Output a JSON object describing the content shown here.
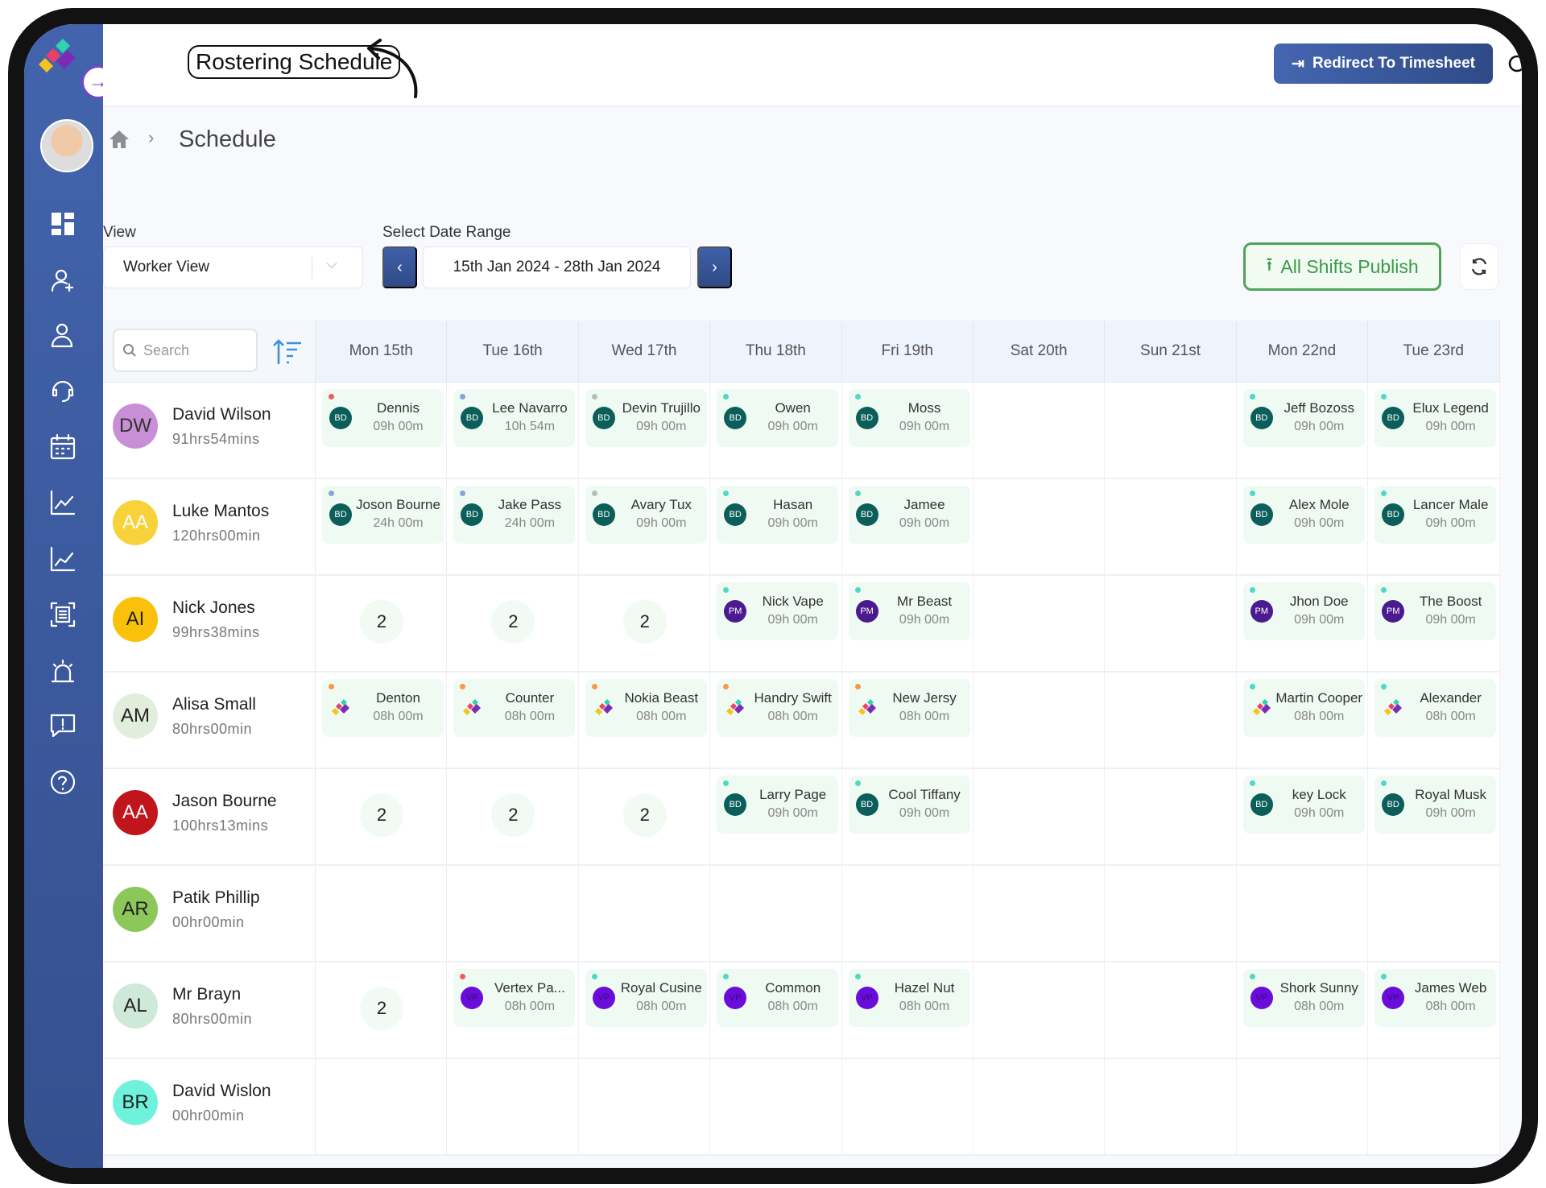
{
  "header": {
    "title": "Rostering Schedule",
    "redirect_label": "Redirect To Timesheet",
    "icons": [
      "search-icon",
      "bell-icon"
    ]
  },
  "breadcrumb": {
    "current": "Schedule"
  },
  "controls": {
    "view_label": "View",
    "view_value": "Worker View",
    "date_label": "Select Date Range",
    "date_value": "15th Jan 2024 - 28th Jan 2024",
    "publish_label": "All Shifts Publish",
    "prev": "‹",
    "next": "›"
  },
  "search": {
    "placeholder": "Search"
  },
  "sidebar": {
    "icons": [
      "dashboard-icon",
      "add-user-icon",
      "users-icon",
      "support-icon",
      "calendar-icon",
      "chart-icon",
      "analytics-icon",
      "report-icon",
      "alarm-icon",
      "feedback-icon",
      "help-icon"
    ]
  },
  "colors": {
    "accent": "#3f5fa8",
    "publish": "#3a9a48",
    "bd": "#0b5e5a",
    "pm": "#4b1a8f",
    "vp": "#6a0ddb",
    "red": "#ef5b5b",
    "blue": "#7fa8d6",
    "grey": "#bbbbbb",
    "teal": "#4fd8c4",
    "orange": "#f59a4a"
  },
  "days": [
    "Mon 15th",
    "Tue 16th",
    "Wed 17th",
    "Thu 18th",
    "Fri 19th",
    "Sat 20th",
    "Sun 21st",
    "Mon 22nd",
    "Tue 23rd"
  ],
  "workers": [
    {
      "name": "David Wilson",
      "initials": "DW",
      "bg": "#c98fd6",
      "fg": "#333",
      "hours": "91hrs54mins",
      "cells": [
        {
          "n": "Dennis",
          "d": "09h 00m",
          "b": "BD",
          "dot": "red"
        },
        {
          "n": "Lee Navarro",
          "d": "10h 54m",
          "b": "BD",
          "dot": "blue"
        },
        {
          "n": "Devin Trujillo",
          "d": "09h 00m",
          "b": "BD",
          "dot": "grey"
        },
        {
          "n": "Owen",
          "d": "09h 00m",
          "b": "BD",
          "dot": "teal"
        },
        {
          "n": "Moss",
          "d": "09h 00m",
          "b": "BD",
          "dot": "teal"
        },
        null,
        null,
        {
          "n": "Jeff Bozoss",
          "d": "09h 00m",
          "b": "BD",
          "dot": "teal"
        },
        {
          "n": "Elux Legend",
          "d": "09h 00m",
          "b": "BD",
          "dot": "teal"
        }
      ]
    },
    {
      "name": "Luke Mantos",
      "initials": "AA",
      "bg": "#f8d23a",
      "fg": "#fff",
      "hours": "120hrs00min",
      "cells": [
        {
          "n": "Joson Bourne",
          "d": "24h 00m",
          "b": "BD",
          "dot": "blue"
        },
        {
          "n": "Jake Pass",
          "d": "24h 00m",
          "b": "BD",
          "dot": "blue"
        },
        {
          "n": "Avary Tux",
          "d": "09h 00m",
          "b": "BD",
          "dot": "grey"
        },
        {
          "n": "Hasan",
          "d": "09h 00m",
          "b": "BD",
          "dot": "teal"
        },
        {
          "n": "Jamee",
          "d": "09h 00m",
          "b": "BD",
          "dot": "teal"
        },
        null,
        null,
        {
          "n": "Alex Mole",
          "d": "09h 00m",
          "b": "BD",
          "dot": "teal"
        },
        {
          "n": "Lancer Male",
          "d": "09h 00m",
          "b": "BD",
          "dot": "teal"
        }
      ]
    },
    {
      "name": "Nick Jones",
      "initials": "AI",
      "bg": "#f9c10c",
      "fg": "#222",
      "hours": "99hrs38mins",
      "cells": [
        {
          "count": "2"
        },
        {
          "count": "2"
        },
        {
          "count": "2"
        },
        {
          "n": "Nick Vape",
          "d": "09h 00m",
          "b": "PM",
          "dot": "teal"
        },
        {
          "n": "Mr Beast",
          "d": "09h 00m",
          "b": "PM",
          "dot": "teal"
        },
        null,
        null,
        {
          "n": "Jhon Doe",
          "d": "09h 00m",
          "b": "PM",
          "dot": "teal"
        },
        {
          "n": "The Boost",
          "d": "09h 00m",
          "b": "PM",
          "dot": "teal"
        }
      ]
    },
    {
      "name": "Alisa Small",
      "initials": "AM",
      "bg": "#e0eedb",
      "fg": "#222",
      "hours": "80hrs00min",
      "cells": [
        {
          "n": "Denton",
          "d": "08h 00m",
          "b": "LOGO",
          "dot": "orange"
        },
        {
          "n": "Counter",
          "d": "08h 00m",
          "b": "LOGO",
          "dot": "orange"
        },
        {
          "n": "Nokia Beast",
          "d": "08h 00m",
          "b": "LOGO",
          "dot": "orange"
        },
        {
          "n": "Handry Swift",
          "d": "08h 00m",
          "b": "LOGO",
          "dot": "orange"
        },
        {
          "n": "New Jersy",
          "d": "08h 00m",
          "b": "LOGO",
          "dot": "orange"
        },
        null,
        null,
        {
          "n": "Martin Cooper",
          "d": "08h 00m",
          "b": "LOGO",
          "dot": "teal"
        },
        {
          "n": "Alexander",
          "d": "08h 00m",
          "b": "LOGO",
          "dot": "teal"
        }
      ]
    },
    {
      "name": "Jason Bourne",
      "initials": "AA",
      "bg": "#c0161b",
      "fg": "#fff",
      "hours": "100hrs13mins",
      "cells": [
        {
          "count": "2"
        },
        {
          "count": "2"
        },
        {
          "count": "2"
        },
        {
          "n": "Larry Page",
          "d": "09h 00m",
          "b": "BD",
          "dot": "teal"
        },
        {
          "n": "Cool Tiffany",
          "d": "09h 00m",
          "b": "BD",
          "dot": "teal"
        },
        null,
        null,
        {
          "n": "key Lock",
          "d": "09h 00m",
          "b": "BD",
          "dot": "teal"
        },
        {
          "n": "Royal Musk",
          "d": "09h 00m",
          "b": "BD",
          "dot": "teal"
        }
      ]
    },
    {
      "name": "Patik Phillip",
      "initials": "AR",
      "bg": "#8cc75a",
      "fg": "#222",
      "hours": "00hr00min",
      "cells": [
        null,
        null,
        null,
        null,
        null,
        null,
        null,
        null,
        null
      ]
    },
    {
      "name": "Mr Brayn",
      "initials": "AL",
      "bg": "#cfe9d8",
      "fg": "#222",
      "hours": "80hrs00min",
      "cells": [
        {
          "count": "2"
        },
        {
          "n": "Vertex Pa...",
          "d": "08h 00m",
          "b": "VP",
          "dot": "red"
        },
        {
          "n": "Royal Cusine",
          "d": "08h 00m",
          "b": "VP",
          "dot": "teal"
        },
        {
          "n": "Common",
          "d": "08h 00m",
          "b": "VP",
          "dot": "teal"
        },
        {
          "n": "Hazel Nut",
          "d": "08h 00m",
          "b": "VP",
          "dot": "teal"
        },
        null,
        null,
        {
          "n": "Shork Sunny",
          "d": "08h 00m",
          "b": "VP",
          "dot": "teal"
        },
        {
          "n": "James Web",
          "d": "08h 00m",
          "b": "VP",
          "dot": "teal"
        }
      ]
    },
    {
      "name": "David Wislon",
      "initials": "BR",
      "bg": "#6ef2dc",
      "fg": "#222",
      "hours": "00hr00min",
      "cells": [
        null,
        null,
        null,
        null,
        null,
        null,
        null,
        null,
        null
      ]
    }
  ]
}
